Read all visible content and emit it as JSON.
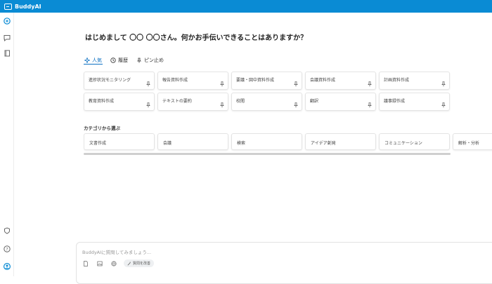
{
  "app": {
    "title": "BuddyAI"
  },
  "greeting": "はじめまして 〇〇 〇〇さん。何かお手伝いできることはありますか？",
  "tabs": [
    {
      "label": "人気",
      "icon": "sparkle-icon",
      "active": true
    },
    {
      "label": "履歴",
      "icon": "history-icon",
      "active": false
    },
    {
      "label": "ピン止め",
      "icon": "pin-icon",
      "active": false
    }
  ],
  "prompt_cards": [
    "進捗状況モニタリング",
    "報告資料作成",
    "要議・図中資料作成",
    "会議資料作成",
    "計画資料作成",
    "教育資料作成",
    "テキストの要約",
    "校閲",
    "翻訳",
    "議事録作成"
  ],
  "category_title": "カテゴリから選ぶ",
  "categories": [
    "文書作成",
    "会議",
    "検索",
    "アイデア創発",
    "コミュニケーション",
    "解析・分析"
  ],
  "input": {
    "placeholder": "BuddyAIに質問してみましょう...",
    "chip_label": "質問を改善"
  },
  "colors": {
    "accent": "#0a8bd4",
    "active_tab": "#0a6fc2"
  }
}
